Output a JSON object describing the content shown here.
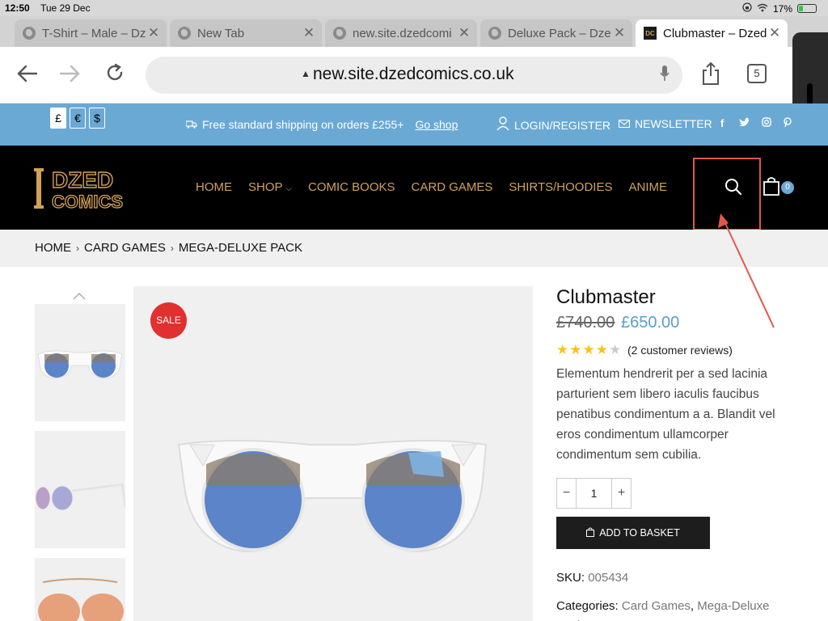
{
  "status_bar": {
    "time": "12:50",
    "date": "Tue 29 Dec",
    "battery": "17%"
  },
  "tabs": [
    {
      "title": "T-Shirt – Male – Dz",
      "active": false
    },
    {
      "title": "New Tab",
      "active": false
    },
    {
      "title": "new.site.dzedcomi",
      "active": false
    },
    {
      "title": "Deluxe Pack – Dze",
      "active": false
    },
    {
      "title": "Clubmaster – Dzed",
      "active": true,
      "favicon": "DC"
    }
  ],
  "browser": {
    "url": "new.site.dzedcomics.co.uk",
    "tab_count": "5"
  },
  "topbar": {
    "currencies": [
      "£",
      "€",
      "$"
    ],
    "shipping_text": "Free standard shipping on orders £255+",
    "shipping_link": "Go shop",
    "login": "LOGIN/REGISTER",
    "newsletter": "NEWSLETTER",
    "social": [
      "f",
      "twitter-icon",
      "instagram-icon",
      "pinterest-icon"
    ]
  },
  "header": {
    "logo_line1": "DZED",
    "logo_line2": "COMICS",
    "nav": [
      "HOME",
      "SHOP",
      "COMIC BOOKS",
      "CARD GAMES",
      "SHIRTS/HOODIES",
      "ANIME"
    ],
    "cart_count": "0"
  },
  "breadcrumb": [
    "HOME",
    "CARD GAMES",
    "MEGA-DELUXE PACK"
  ],
  "product": {
    "sale_badge": "SALE",
    "title": "Clubmaster",
    "price_old": "£740.00",
    "price_new": "£650.00",
    "rating": 4.5,
    "reviews": "(2 customer reviews)",
    "description": "Elementum hendrerit per a sed lacinia parturient sem libero iaculis faucibus penatibus condimentum a a. Blandit vel eros condimentum ullamcorper condimentum sem cubilia.",
    "quantity": "1",
    "add_to_basket": "ADD TO BASKET",
    "sku_label": "SKU:",
    "sku": "005434",
    "categories_label": "Categories:",
    "categories": [
      "Card Games",
      "Mega-Deluxe Pack"
    ]
  },
  "colors": {
    "topbar_blue": "#6aa9d4",
    "nav_gold": "#d2a15a",
    "sale_red": "#e0302f",
    "highlight_red": "#e2574c"
  }
}
